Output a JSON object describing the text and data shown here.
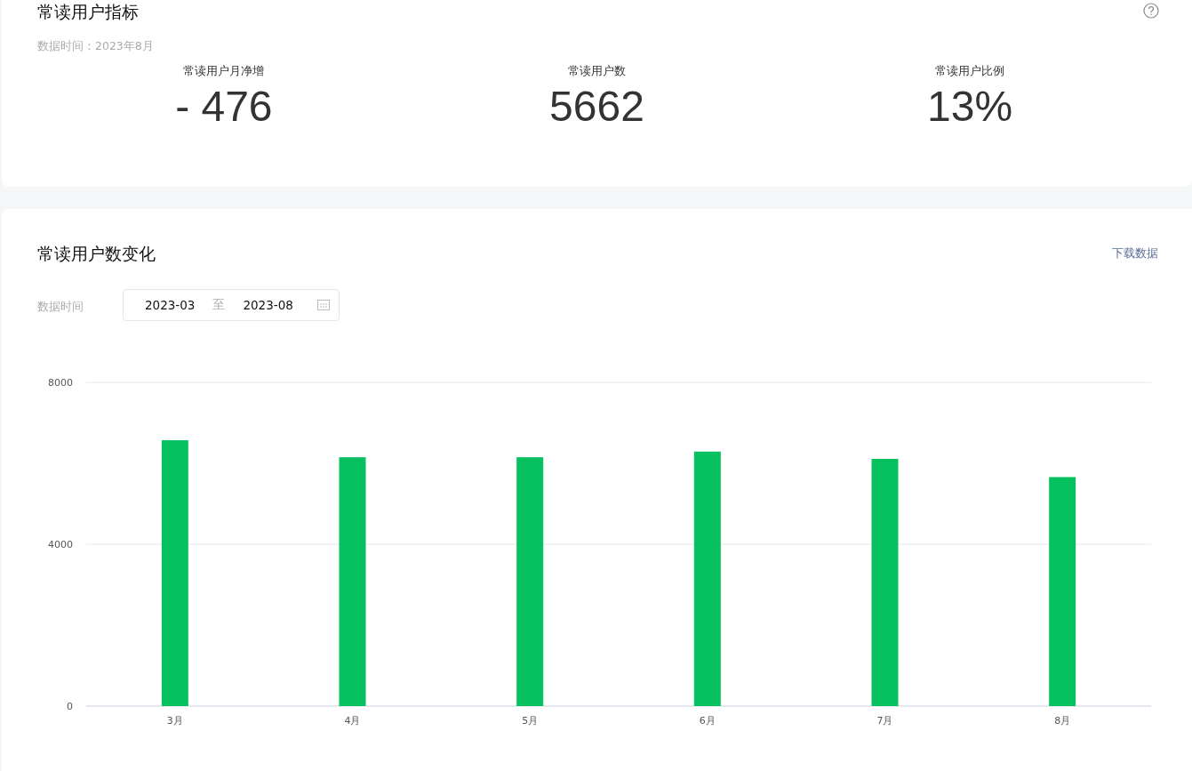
{
  "metrics_card": {
    "title": "常读用户指标",
    "data_time": "数据时间：2023年8月",
    "metrics": [
      {
        "label": "常读用户月净增",
        "value": "- 476"
      },
      {
        "label": "常读用户数",
        "value": "5662"
      },
      {
        "label": "常读用户比例",
        "value": "13%"
      }
    ]
  },
  "trend_card": {
    "title": "常读用户数变化",
    "download_link": "下载数据",
    "filter_label": "数据时间",
    "date_range": {
      "start": "2023-03",
      "separator": "至",
      "end": "2023-08"
    },
    "chart_data": {
      "type": "bar",
      "categories": [
        "3月",
        "4月",
        "5月",
        "6月",
        "7月",
        "8月"
      ],
      "series": [
        {
          "color": "#07c160",
          "values": [
            6570,
            6150,
            6150,
            6290,
            6110,
            5660
          ]
        }
      ],
      "ylim": [
        0,
        8000
      ],
      "yticks": [
        0,
        4000,
        8000
      ]
    }
  }
}
